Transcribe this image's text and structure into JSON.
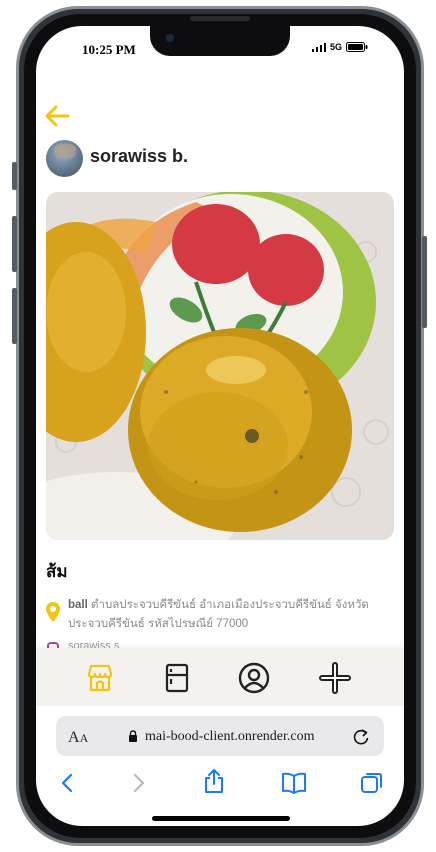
{
  "status_bar": {
    "time": "10:25 PM",
    "network": "5G"
  },
  "post": {
    "username": "sorawiss b.",
    "title": "ส้ม",
    "location_name": "ball",
    "address": "ตำบลประจวบคีรีขันธ์ อำเภอเมืองประจวบคีรีขันธ์ จังหวัดประจวบคีรีขันธ์ รหัสไปรษณีย์ 77000",
    "instagram": "sorawiss s"
  },
  "browser": {
    "text_size_label_big": "A",
    "text_size_label_small": "A",
    "url": "mai-bood-client.onrender.com"
  },
  "colors": {
    "accent": "#f2c511",
    "text": "#222222",
    "ios_blue": "#1a7cf2"
  },
  "icons": {
    "back": "arrow-left-icon",
    "nav": [
      "shop-icon",
      "fridge-icon",
      "profile-icon",
      "plus-icon"
    ],
    "toolbar": [
      "back-chevron-icon",
      "forward-chevron-icon",
      "share-icon",
      "bookmarks-icon",
      "tabs-icon"
    ]
  }
}
